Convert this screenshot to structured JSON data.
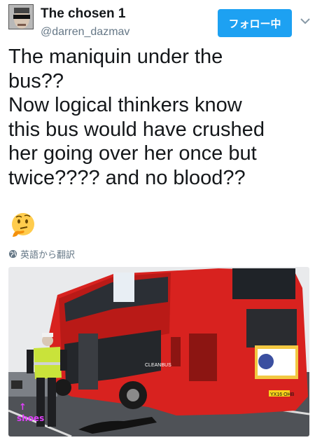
{
  "tweet": {
    "display_name": "The chosen 1",
    "handle": "@darren_dazmav",
    "follow_label": "フォロー中",
    "text_lines": [
      "The maniquin under the",
      "bus??",
      "Now logical thinkers know",
      "this bus would have crushed",
      "her going over her once but",
      "twice???? and no blood??"
    ],
    "emoji": "thinking-face-emoji",
    "translate_label": "英語から翻訳"
  },
  "photo": {
    "annotation_label": "shoes",
    "annotation_arrow": "↑",
    "bus_plate": "YX16 OHB",
    "bus_side_text": "CLEANBUS"
  },
  "colors": {
    "follow_button": "#1da1f2",
    "secondary_text": "#657786",
    "bus_red": "#d8221f",
    "annotation": "#e040fb"
  }
}
